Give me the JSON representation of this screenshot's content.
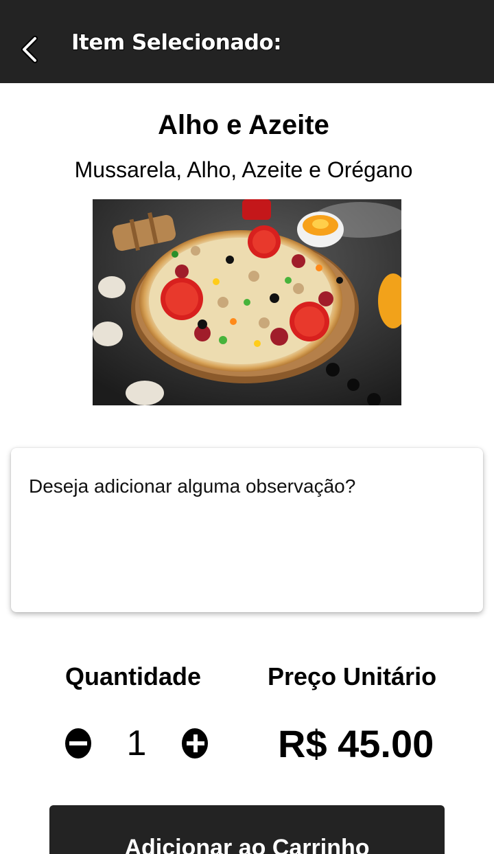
{
  "header": {
    "title": "Item Selecionado:",
    "back_icon": "chevron-left-icon"
  },
  "item": {
    "name": "Alho e Azeite",
    "description": "Mussarela, Alho, Azeite e Orégano"
  },
  "note": {
    "placeholder": "Deseja adicionar alguma observação?",
    "value": ""
  },
  "quantity": {
    "label": "Quantidade",
    "value": "1",
    "minus_icon": "minus-circle-icon",
    "plus_icon": "plus-circle-icon"
  },
  "price": {
    "label": "Preço Unitário",
    "value": "R$ 45.00"
  },
  "actions": {
    "add_to_cart": "Adicionar ao Carrinho"
  },
  "colors": {
    "header_bg": "#232323",
    "button_bg": "#232323",
    "text": "#000000"
  }
}
